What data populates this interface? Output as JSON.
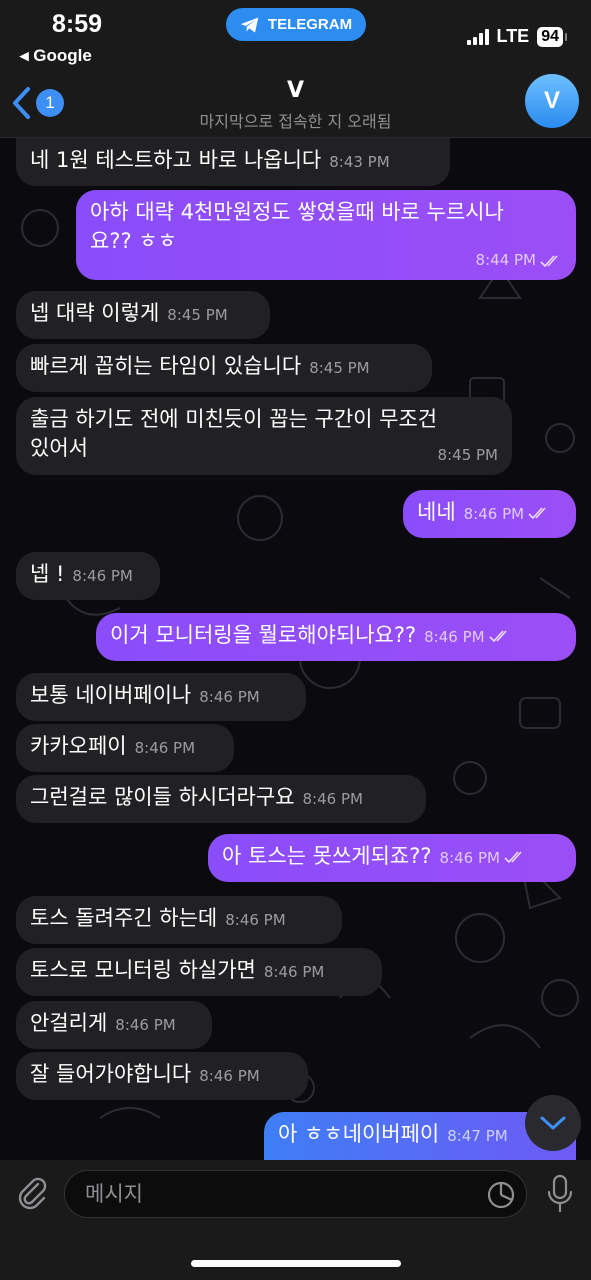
{
  "status_bar": {
    "time": "8:59",
    "back_app": "◂ Google",
    "app_pill": "TELEGRAM",
    "network": "LTE",
    "battery": "94"
  },
  "header": {
    "back_badge": "1",
    "title": "V",
    "subtitle": "마지막으로 접속한 지 오래됨",
    "avatar_letter": "V"
  },
  "messages": [
    {
      "dir": "in",
      "text": "네 1원 테스트하고 바로 나옵니다",
      "time": "8:43 PM"
    },
    {
      "dir": "out",
      "text1": "아하 대략 4천만원정도 쌓였을때 바로 누르시나",
      "text2": "요?? ㅎㅎ",
      "time": "8:44 PM"
    },
    {
      "dir": "in",
      "text": "넵 대략 이렇게",
      "time": "8:45 PM"
    },
    {
      "dir": "in",
      "text": "빠르게 꼽히는 타임이 있습니다",
      "time": "8:45 PM"
    },
    {
      "dir": "in",
      "text1": "출금 하기도 전에 미친듯이 꼽는 구간이 무조건",
      "text2": "있어서",
      "time": "8:45 PM"
    },
    {
      "dir": "out",
      "text": "네네",
      "time": "8:46 PM"
    },
    {
      "dir": "in",
      "text": "넵 !",
      "time": "8:46 PM"
    },
    {
      "dir": "out",
      "text": "이거 모니터링을 뭘로해야되나요??",
      "time": "8:46 PM"
    },
    {
      "dir": "in",
      "text": "보통 네이버페이나",
      "time": "8:46 PM"
    },
    {
      "dir": "in",
      "text": "카카오페이",
      "time": "8:46 PM"
    },
    {
      "dir": "in",
      "text": "그런걸로 많이들 하시더라구요",
      "time": "8:46 PM"
    },
    {
      "dir": "out",
      "text": "아 토스는 못쓰게되죠??",
      "time": "8:46 PM"
    },
    {
      "dir": "in",
      "text": "토스 돌려주긴 하는데",
      "time": "8:46 PM"
    },
    {
      "dir": "in",
      "text": "토스로 모니터링 하실가면",
      "time": "8:46 PM"
    },
    {
      "dir": "in",
      "text": "안걸리게",
      "time": "8:46 PM"
    },
    {
      "dir": "in",
      "text": "잘 들어가야합니다",
      "time": "8:46 PM"
    },
    {
      "dir": "out",
      "text": "아 ㅎㅎ네이버페이",
      "time": "8:47 PM"
    }
  ],
  "input": {
    "placeholder": "메시지"
  },
  "icons": {
    "attach": "paperclip-icon",
    "sticker": "sticker-icon",
    "mic": "microphone-icon",
    "scroll": "chevron-down-icon"
  },
  "colors": {
    "outgoing": "#9b4ef6",
    "incoming": "#212124",
    "accent": "#3d8ff5"
  }
}
